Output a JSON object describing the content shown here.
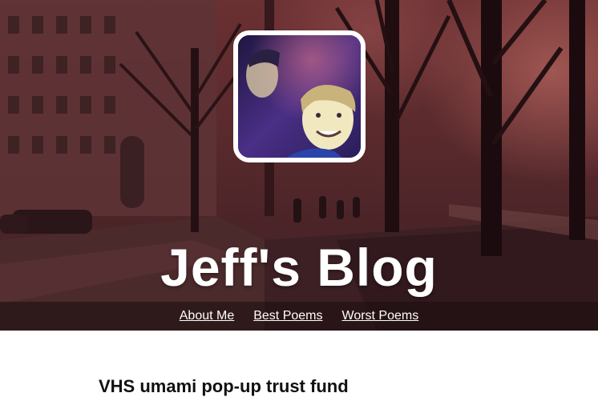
{
  "site": {
    "title": "Jeff's Blog"
  },
  "nav": {
    "items": [
      {
        "label": "About Me"
      },
      {
        "label": "Best Poems"
      },
      {
        "label": "Worst Poems"
      }
    ]
  },
  "posts": [
    {
      "title": "VHS umami pop-up trust fund"
    }
  ],
  "colors": {
    "hero_tint": "#5a2a2d",
    "nav_bar": "#190c0f",
    "avatar_border": "#ffffff",
    "title_text": "#ffffff",
    "post_title": "#111111"
  }
}
